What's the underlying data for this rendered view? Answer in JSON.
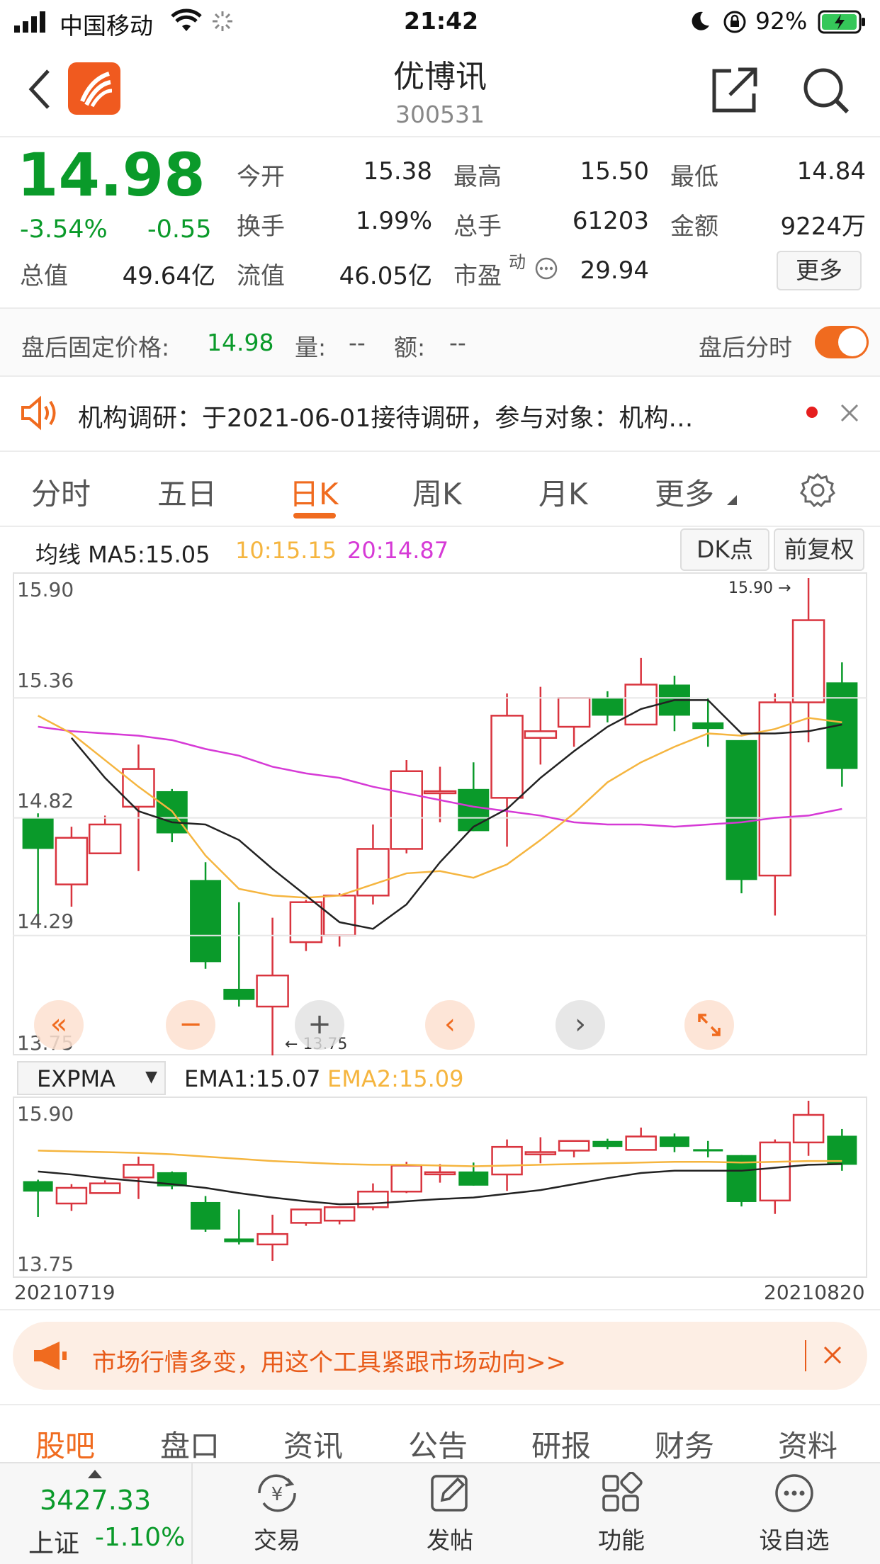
{
  "status": {
    "carrier": "中国移动",
    "time": "21:42",
    "battery": "92%"
  },
  "header": {
    "title": "优博讯",
    "code": "300531"
  },
  "quote": {
    "price": "14.98",
    "pct": "-3.54%",
    "chg": "-0.55",
    "open_label": "今开",
    "open": "15.38",
    "high_label": "最高",
    "high": "15.50",
    "low_label": "最低",
    "low": "14.84",
    "turnover_label": "换手",
    "turnover": "1.99%",
    "volume_label": "总手",
    "volume": "61203",
    "amount_label": "金额",
    "amount": "9224万",
    "mcap_label": "总值",
    "mcap": "49.64亿",
    "float_label": "流值",
    "float": "46.05亿",
    "pe_label": "市盈",
    "pe_sup": "动",
    "pe": "29.94",
    "more": "更多"
  },
  "afterhours": {
    "label": "盘后固定价格:",
    "price": "14.98",
    "vol_label": "量:",
    "vol": "--",
    "amt_label": "额:",
    "amt": "--",
    "toggle_label": "盘后分时",
    "toggle_on": true
  },
  "notice": {
    "text": "机构调研：于2021-06-01接待调研，参与对象：机构…"
  },
  "tabs": [
    "分时",
    "五日",
    "日K",
    "周K",
    "月K",
    "更多"
  ],
  "selected_tab": 2,
  "ma": {
    "label": "均线 MA5:15.05",
    "ma10": "10:15.15",
    "ma20": "20:14.87",
    "dk": "DK点",
    "fq": "前复权"
  },
  "colors": {
    "up": "#d9343e",
    "down": "#0a9a2a",
    "ma5": "#222222",
    "ma10": "#f5b53f",
    "ma20": "#d63ad6",
    "accent": "#f06b1f"
  },
  "chart_data": [
    {
      "type": "candlestick",
      "title": "",
      "y_ticks": [
        "15.90",
        "15.36",
        "14.82",
        "14.29",
        "13.75"
      ],
      "ylim": [
        13.75,
        15.9
      ],
      "max_label": "15.90",
      "min_label": "13.75",
      "candles": [
        {
          "o": 14.82,
          "c": 14.68,
          "h": 14.84,
          "l": 14.34
        },
        {
          "o": 14.52,
          "c": 14.73,
          "h": 14.78,
          "l": 14.42
        },
        {
          "o": 14.66,
          "c": 14.79,
          "h": 14.83,
          "l": 14.66
        },
        {
          "o": 14.87,
          "c": 15.04,
          "h": 15.15,
          "l": 14.58
        },
        {
          "o": 14.94,
          "c": 14.75,
          "h": 14.95,
          "l": 14.71
        },
        {
          "o": 14.54,
          "c": 14.17,
          "h": 14.62,
          "l": 14.14
        },
        {
          "o": 14.05,
          "c": 14.0,
          "h": 14.44,
          "l": 13.97
        },
        {
          "o": 13.97,
          "c": 14.11,
          "h": 14.37,
          "l": 13.75
        },
        {
          "o": 14.26,
          "c": 14.44,
          "h": 14.45,
          "l": 14.22
        },
        {
          "o": 14.29,
          "c": 14.47,
          "h": 14.48,
          "l": 14.24
        },
        {
          "o": 14.47,
          "c": 14.68,
          "h": 14.79,
          "l": 14.43
        },
        {
          "o": 14.68,
          "c": 15.03,
          "h": 15.08,
          "l": 14.66
        },
        {
          "o": 14.94,
          "c": 14.94,
          "h": 15.05,
          "l": 14.8
        },
        {
          "o": 14.95,
          "c": 14.76,
          "h": 15.07,
          "l": 14.76
        },
        {
          "o": 14.91,
          "c": 15.28,
          "h": 15.38,
          "l": 14.69
        },
        {
          "o": 15.18,
          "c": 15.21,
          "h": 15.41,
          "l": 15.06
        },
        {
          "o": 15.23,
          "c": 15.36,
          "h": 15.36,
          "l": 15.14
        },
        {
          "o": 15.36,
          "c": 15.28,
          "h": 15.39,
          "l": 15.25
        },
        {
          "o": 15.24,
          "c": 15.42,
          "h": 15.54,
          "l": 15.24
        },
        {
          "o": 15.42,
          "c": 15.28,
          "h": 15.46,
          "l": 15.21
        },
        {
          "o": 15.25,
          "c": 15.22,
          "h": 15.36,
          "l": 15.14
        },
        {
          "o": 15.17,
          "c": 14.54,
          "h": 15.17,
          "l": 14.48
        },
        {
          "o": 14.56,
          "c": 15.34,
          "h": 15.38,
          "l": 14.38
        },
        {
          "o": 15.34,
          "c": 15.71,
          "h": 15.9,
          "l": 15.16
        },
        {
          "o": 15.43,
          "c": 15.04,
          "h": 15.52,
          "l": 14.96
        }
      ],
      "ma5": [
        15.18,
        15.0,
        14.85,
        14.8,
        14.79,
        14.72,
        14.59,
        14.47,
        14.35,
        14.32,
        14.43,
        14.62,
        14.78,
        14.86,
        15.0,
        15.12,
        15.23,
        15.31,
        15.35,
        15.35,
        15.2,
        15.2,
        15.21,
        15.24
      ],
      "ma10": [
        15.28,
        15.2,
        15.08,
        14.96,
        14.85,
        14.65,
        14.5,
        14.47,
        14.46,
        14.47,
        14.52,
        14.57,
        14.58,
        14.55,
        14.61,
        14.72,
        14.84,
        14.98,
        15.07,
        15.14,
        15.2,
        15.19,
        15.22,
        15.27,
        15.25
      ],
      "ma20": [
        15.23,
        15.21,
        15.2,
        15.19,
        15.17,
        15.13,
        15.1,
        15.05,
        15.02,
        15.0,
        14.96,
        14.93,
        14.9,
        14.87,
        14.85,
        14.83,
        14.8,
        14.79,
        14.79,
        14.78,
        14.79,
        14.8,
        14.82,
        14.83,
        14.86
      ]
    },
    {
      "type": "candlestick",
      "title": "",
      "indicator": "EXPMA",
      "ema1_label": "EMA1:15.07",
      "ema2_label": "EMA2:15.09",
      "y_ticks": [
        "15.90",
        "13.75"
      ],
      "ylim": [
        13.75,
        15.9
      ],
      "date_start": "20210719",
      "date_end": "20210820",
      "ema1": [
        14.95,
        14.91,
        14.86,
        14.82,
        14.78,
        14.73,
        14.66,
        14.6,
        14.55,
        14.51,
        14.52,
        14.55,
        14.58,
        14.6,
        14.65,
        14.7,
        14.78,
        14.86,
        14.93,
        14.96,
        14.96,
        14.96,
        15.0,
        15.04,
        15.05
      ],
      "ema2": [
        15.23,
        15.22,
        15.21,
        15.2,
        15.18,
        15.15,
        15.12,
        15.09,
        15.07,
        15.05,
        15.04,
        15.04,
        15.03,
        15.02,
        15.03,
        15.04,
        15.05,
        15.06,
        15.07,
        15.08,
        15.08,
        15.07,
        15.08,
        15.09,
        15.09
      ]
    }
  ],
  "ad": {
    "text": "市场行情多变，用这个工具紧跟市场动向>>"
  },
  "subtabs": [
    "股吧",
    "盘口",
    "资讯",
    "公告",
    "研报",
    "财务",
    "资料"
  ],
  "selected_subtab": 0,
  "bottom": {
    "index_value": "3427.33",
    "index_name": "上证",
    "index_pct": "-1.10%"
  },
  "nav": [
    "交易",
    "发帖",
    "功能",
    "设自选"
  ]
}
